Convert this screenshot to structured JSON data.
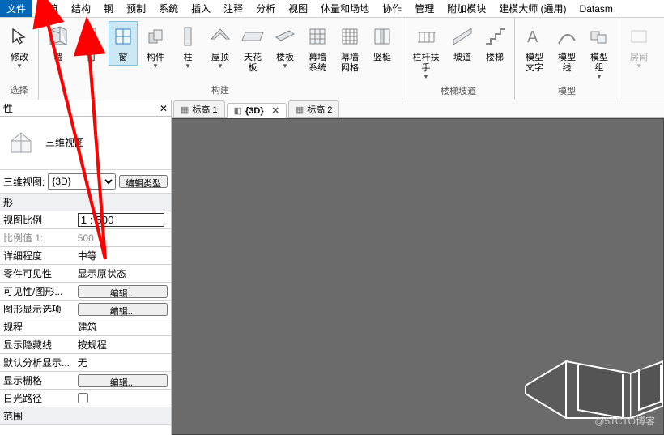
{
  "menubar": {
    "file": "文件",
    "items": [
      "建筑",
      "结构",
      "钢",
      "预制",
      "系统",
      "插入",
      "注释",
      "分析",
      "视图",
      "体量和场地",
      "协作",
      "管理",
      "附加模块",
      "建模大师 (通用)",
      "Datasm"
    ],
    "active_index": 0
  },
  "ribbon": {
    "modify": "修改",
    "select": "选择",
    "build_group_label": "构建",
    "slope_group_label": "楼梯坡道",
    "model_group_label": "模型",
    "btns": {
      "wall": "墙",
      "door": "门",
      "window": "窗",
      "component": "构件",
      "column": "柱",
      "roof": "屋顶",
      "ceiling": "天花板",
      "floor": "楼板",
      "curtain_sys": "幕墙\n系统",
      "curtain_grid": "幕墙\n网格",
      "mullion": "竖梃",
      "railing": "栏杆扶手",
      "ramp": "坡道",
      "stair": "楼梯",
      "model_text": "模型\n文字",
      "model_line": "模型\n线",
      "model_group": "模型\n组",
      "room": "房间"
    }
  },
  "props": {
    "header": "性",
    "view3d_label": "三维视图",
    "view_label_prefix": "三维视图:",
    "view_name": "{3D}",
    "edit_type_btn": "编辑类型",
    "section_graphics": "形",
    "section_extent": "范围",
    "rows": {
      "scale_label": "视图比例",
      "scale_value": "1 : 500",
      "scale_val_label": "比例值 1:",
      "scale_val_value": "500",
      "detail_label": "详细程度",
      "detail_value": "中等",
      "part_vis_label": "零件可见性",
      "part_vis_value": "显示原状态",
      "vis_gfx_label": "可见性/图形...",
      "vis_gfx_btn": "编辑...",
      "gfx_opt_label": "图形显示选项",
      "gfx_opt_btn": "编辑...",
      "discipline_label": "规程",
      "discipline_value": "建筑",
      "hide_line_label": "显示隐藏线",
      "hide_line_value": "按规程",
      "default_ana_label": "默认分析显示...",
      "default_ana_value": "无",
      "show_grid_label": "显示栅格",
      "show_grid_btn": "编辑...",
      "sun_path_label": "日光路径",
      "sun_path_value": ""
    }
  },
  "tabs": {
    "t1": "标高 1",
    "t2": "{3D}",
    "t3": "标高 2"
  },
  "watermark": "@51CTO博客"
}
